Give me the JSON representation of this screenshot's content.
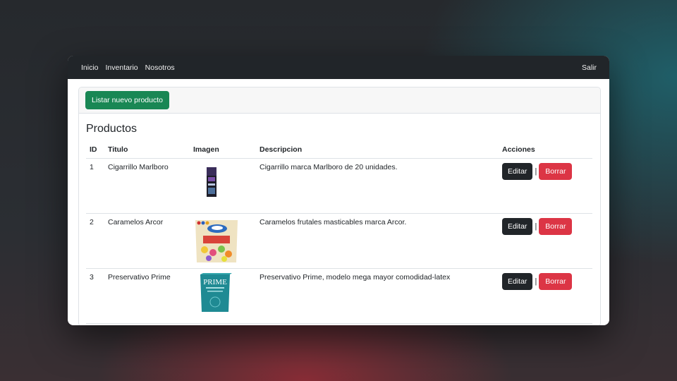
{
  "navbar": {
    "links": [
      "Inicio",
      "Inventario",
      "Nosotros"
    ],
    "logout": "Salir"
  },
  "card": {
    "new_button": "Listar nuevo producto",
    "title": "Productos"
  },
  "table": {
    "headers": [
      "ID",
      "Titulo",
      "Imagen",
      "Descripcion",
      "Acciones"
    ],
    "rows": [
      {
        "id": "1",
        "title": "Cigarrillo Marlboro",
        "image": "cigarette-pack-image",
        "description": "Cigarrillo marca Marlboro de 20 unidades.",
        "edit": "Editar",
        "sep": "|",
        "delete": "Borrar"
      },
      {
        "id": "2",
        "title": "Caramelos Arcor",
        "image": "candy-bag-image",
        "description": "Caramelos frutales masticables marca Arcor.",
        "edit": "Editar",
        "sep": "|",
        "delete": "Borrar"
      },
      {
        "id": "3",
        "title": "Preservativo Prime",
        "image": "prime-box-image",
        "description": "Preservativo Prime, modelo mega mayor comodidad-latex",
        "edit": "Editar",
        "sep": "|",
        "delete": "Borrar",
        "image_text": "PRIME"
      }
    ]
  },
  "colors": {
    "navbar": "#212529",
    "success": "#198754",
    "danger": "#dc3545",
    "dark": "#212529"
  }
}
